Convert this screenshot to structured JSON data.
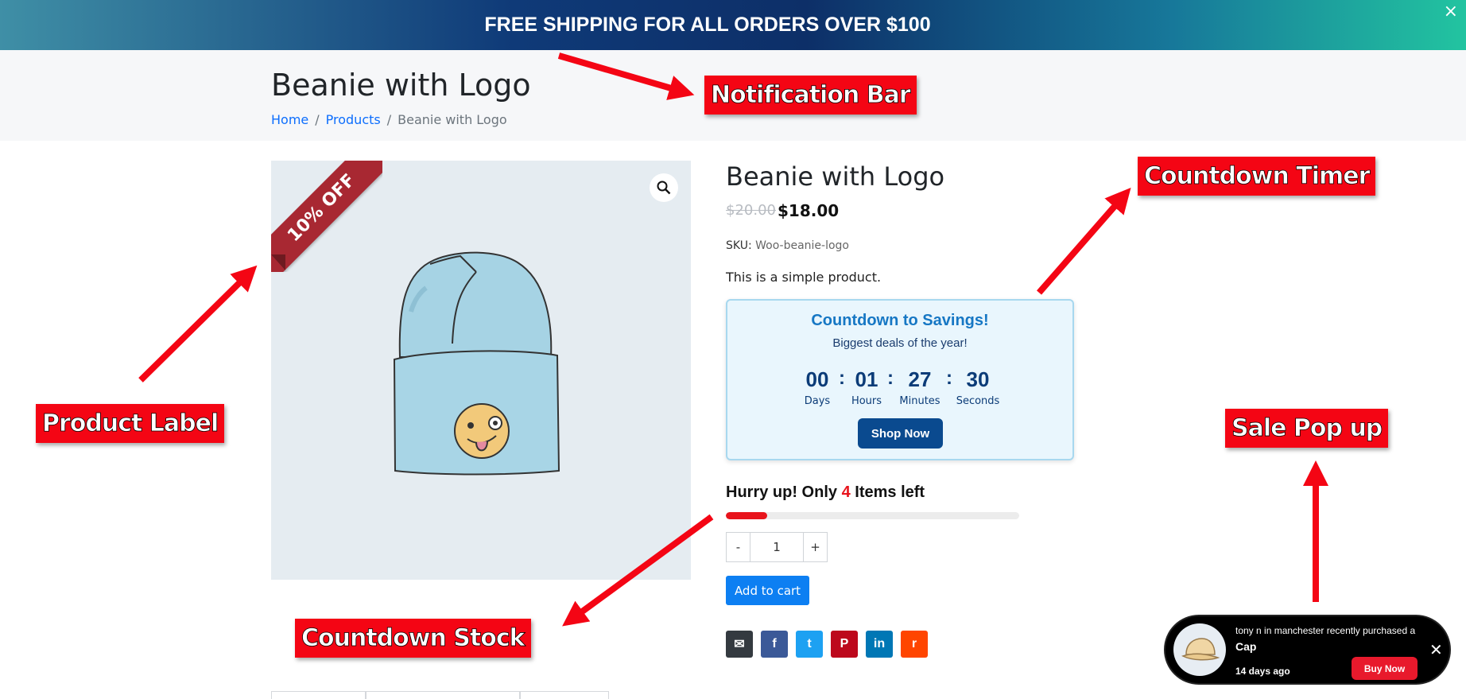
{
  "notification_bar": {
    "text": "FREE SHIPPING FOR ALL ORDERS OVER $100",
    "close_glyph": "×",
    "gradient_colors": [
      "#3f8fa6",
      "#0f3a78",
      "#22c4a0"
    ]
  },
  "page_header": {
    "title": "Beanie with Logo",
    "breadcrumb": [
      {
        "label": "Home"
      },
      {
        "label": "Products"
      },
      {
        "label": "Beanie with Logo"
      }
    ],
    "separator": "/"
  },
  "product_image": {
    "ribbon_text": "10% OFF",
    "ribbon_color": "#a82832",
    "zoom_icon": "magnifier-icon",
    "image_icon": "beanie-illustration"
  },
  "product": {
    "title": "Beanie with Logo",
    "price_old": "$20.00",
    "price_new": "$18.00",
    "sku_label": "SKU:",
    "sku_value": "Woo-beanie-logo",
    "description": "This is a simple product."
  },
  "countdown": {
    "heading": "Countdown to Savings!",
    "subheading": "Biggest deals of the year!",
    "units": [
      {
        "value": "00",
        "label": "Days"
      },
      {
        "value": "01",
        "label": "Hours"
      },
      {
        "value": "27",
        "label": "Minutes"
      },
      {
        "value": "30",
        "label": "Seconds"
      }
    ],
    "separator": ":",
    "button_label": "Shop Now",
    "accent_color": "#0a4a8f"
  },
  "stock": {
    "prefix": "Hurry up! Only ",
    "count": "4",
    "suffix": " Items left",
    "progress_fraction": 0.14,
    "bar_color": "#e8141c"
  },
  "quantity": {
    "minus": "-",
    "value": "1",
    "plus": "+"
  },
  "add_to_cart_label": "Add to cart",
  "share": [
    {
      "icon": "email-icon",
      "glyph": "✉",
      "color": "#343a40"
    },
    {
      "icon": "facebook-icon",
      "glyph": "f",
      "color": "#3b5998"
    },
    {
      "icon": "twitter-icon",
      "glyph": "t",
      "color": "#1da1f2"
    },
    {
      "icon": "pinterest-icon",
      "glyph": "P",
      "color": "#bd081c"
    },
    {
      "icon": "linkedin-icon",
      "glyph": "in",
      "color": "#0077b5"
    },
    {
      "icon": "reddit-icon",
      "glyph": "r",
      "color": "#ff4500"
    }
  ],
  "sale_popup": {
    "message": "tony n in manchester recently purchased a",
    "product": "Cap",
    "time": "14 days ago",
    "button_label": "Buy Now",
    "close_glyph": "✕",
    "image_icon": "cap-icon"
  },
  "annotations": {
    "notification_bar": "Notification Bar",
    "countdown_timer": "Countdown Timer",
    "product_label": "Product Label",
    "sale_popup": "Sale Pop up",
    "countdown_stock": "Countdown Stock",
    "color": "#f40514"
  }
}
